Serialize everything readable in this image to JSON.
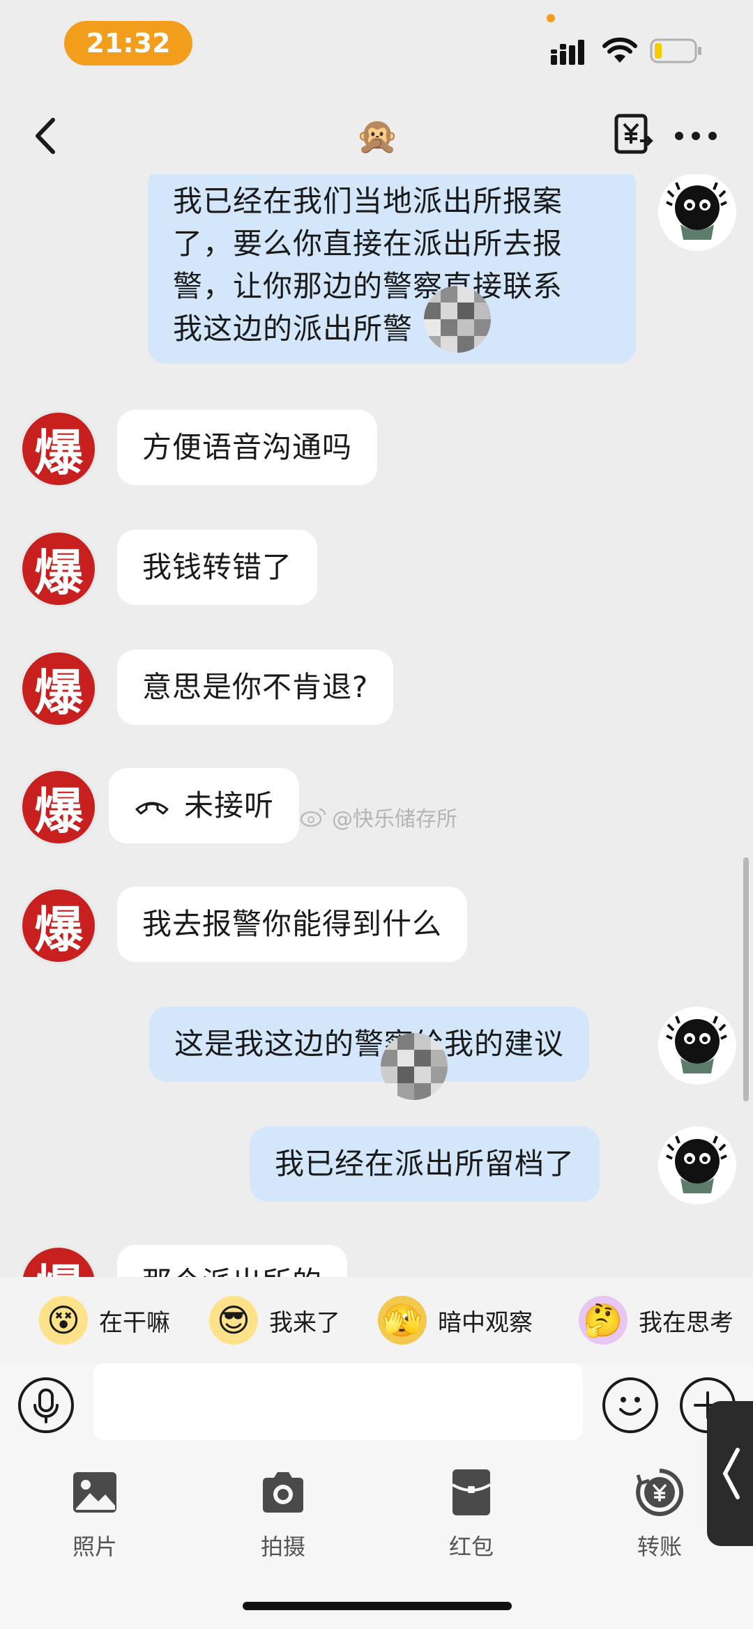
{
  "status_bar": {
    "time": "21:32"
  },
  "nav": {
    "title_emoji": "🙊"
  },
  "messages": [
    {
      "side": "out",
      "text_lines": [
        "我已经在我们当地派出所报案",
        "了，要么你直接在派出所去报",
        "警，让你那边的警察直接联系",
        "我这边的派出所警"
      ]
    },
    {
      "side": "in",
      "avatar_text": "爆",
      "text": "方便语音沟通吗"
    },
    {
      "side": "in",
      "avatar_text": "爆",
      "text": "我钱转错了"
    },
    {
      "side": "in",
      "avatar_text": "爆",
      "text": "意思是你不肯退?"
    },
    {
      "side": "in",
      "avatar_text": "爆",
      "text": "未接听",
      "type": "call"
    },
    {
      "side": "in",
      "avatar_text": "爆",
      "text": "我去报警你能得到什么"
    },
    {
      "side": "out",
      "text": "这是我这边的警察给我的建议"
    },
    {
      "side": "out",
      "text": "我已经在派出所留档了"
    },
    {
      "side": "in",
      "avatar_text": "爆",
      "text": "那个派出所的"
    }
  ],
  "watermark": "@快乐储存所",
  "stickers": [
    {
      "label": "在干嘛",
      "face": "😵"
    },
    {
      "label": "我来了",
      "face": "😎"
    },
    {
      "label": "暗中观察",
      "face": "🫣"
    },
    {
      "label": "我在思考",
      "face": "🤔"
    }
  ],
  "input": {
    "placeholder": ""
  },
  "tools": [
    {
      "label": "照片",
      "icon": "photo-icon"
    },
    {
      "label": "拍摄",
      "icon": "camera-icon"
    },
    {
      "label": "红包",
      "icon": "red-packet-icon"
    },
    {
      "label": "转账",
      "icon": "transfer-icon"
    }
  ]
}
